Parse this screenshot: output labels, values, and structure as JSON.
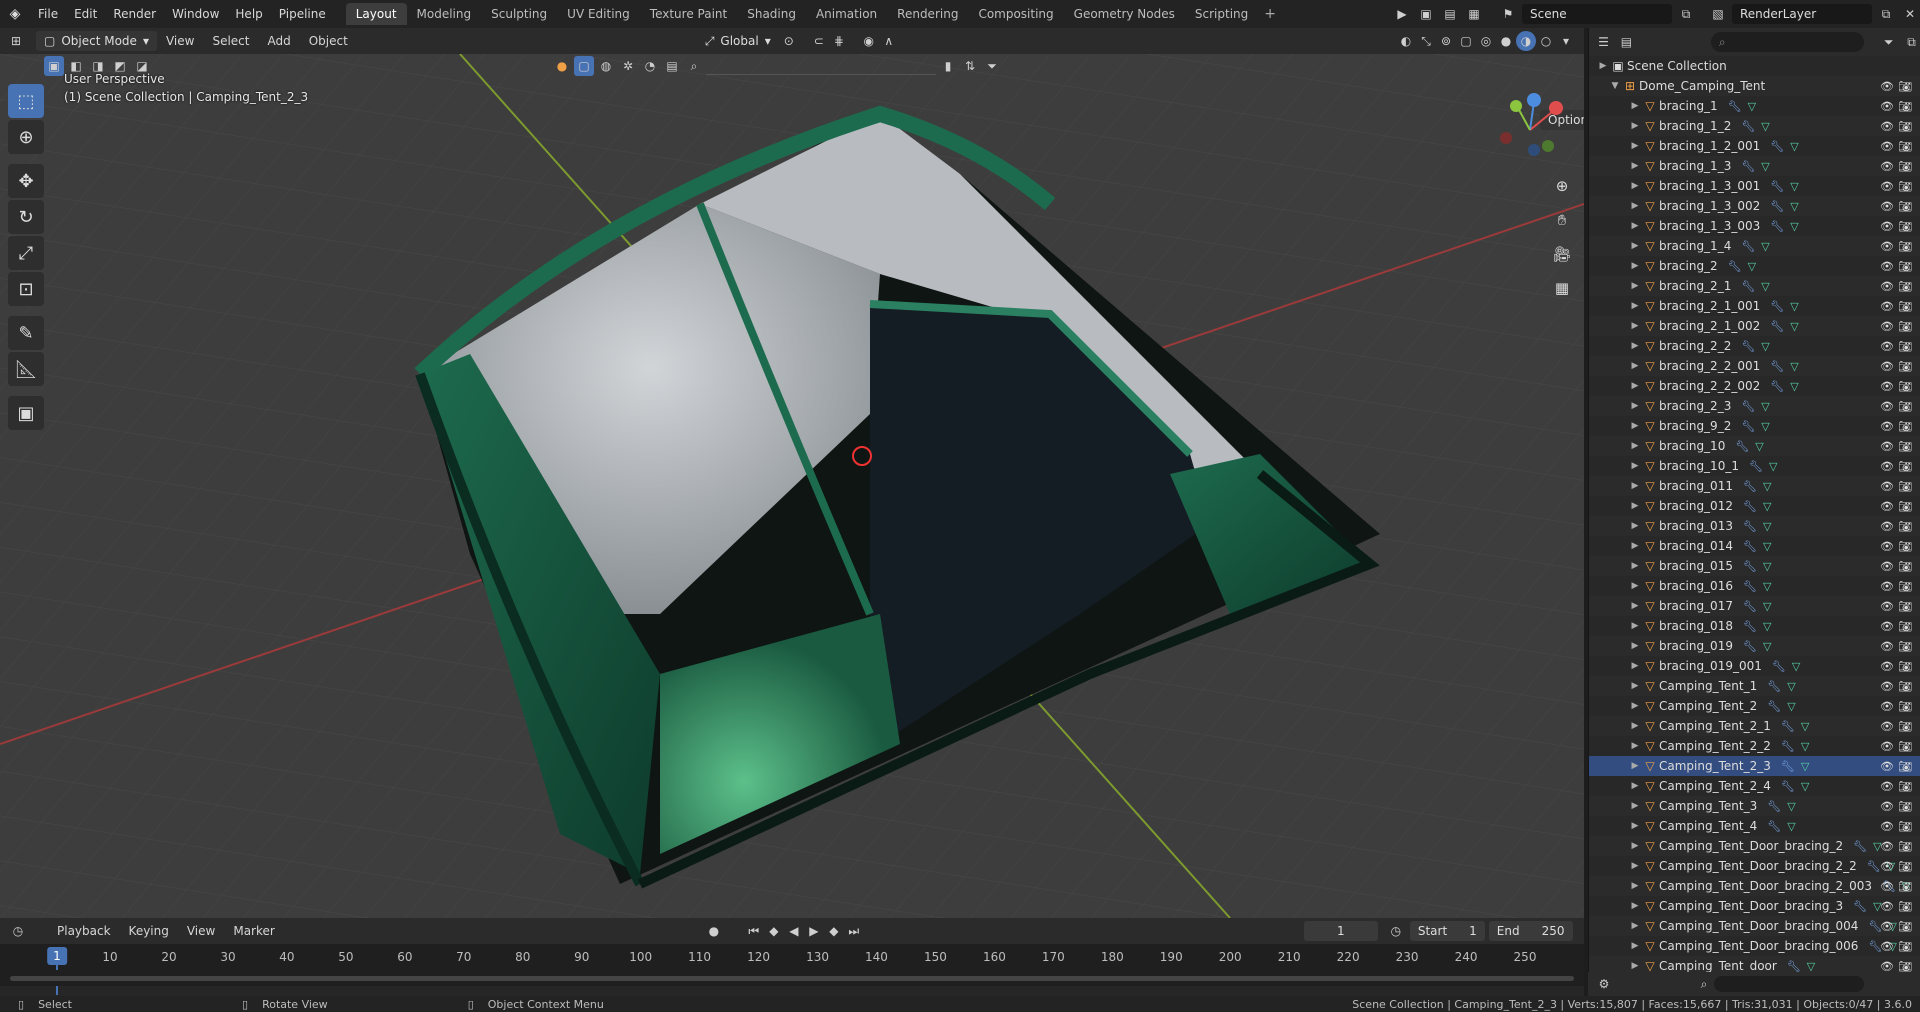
{
  "topbar": {
    "menus": [
      "File",
      "Edit",
      "Render",
      "Window",
      "Help",
      "Pipeline"
    ],
    "workspaces": [
      "Layout",
      "Modeling",
      "Sculpting",
      "UV Editing",
      "Texture Paint",
      "Shading",
      "Animation",
      "Rendering",
      "Compositing",
      "Geometry Nodes",
      "Scripting"
    ],
    "active_workspace": "Layout",
    "scene": "Scene",
    "view_layer": "RenderLayer"
  },
  "viewport_header": {
    "mode": "Object Mode",
    "menus": [
      "View",
      "Select",
      "Add",
      "Object"
    ],
    "orientation": "Global",
    "options_label": "Options"
  },
  "viewport": {
    "perspective": "User Perspective",
    "context": "(1) Scene Collection | Camping_Tent_2_3"
  },
  "timeline": {
    "menus": [
      "Playback",
      "Keying",
      "View",
      "Marker"
    ],
    "current_frame": "1",
    "start_label": "Start",
    "start_value": "1",
    "end_label": "End",
    "end_value": "250",
    "ticks": [
      "1",
      "10",
      "20",
      "30",
      "40",
      "50",
      "60",
      "70",
      "80",
      "90",
      "100",
      "110",
      "120",
      "130",
      "140",
      "150",
      "160",
      "170",
      "180",
      "190",
      "200",
      "210",
      "220",
      "230",
      "240",
      "250"
    ]
  },
  "status": {
    "select": "Select",
    "rotate": "Rotate View",
    "context_menu": "Object Context Menu",
    "stats": "Scene Collection | Camping_Tent_2_3 | Verts:15,807 | Faces:15,667 | Tris:31,031 | Objects:0/47 | 3.6.0"
  },
  "outliner": {
    "root": "Scene Collection",
    "collection": "Dome_Camping_Tent",
    "items": [
      "bracing_1",
      "bracing_1_2",
      "bracing_1_2_001",
      "bracing_1_3",
      "bracing_1_3_001",
      "bracing_1_3_002",
      "bracing_1_3_003",
      "bracing_1_4",
      "bracing_2",
      "bracing_2_1",
      "bracing_2_1_001",
      "bracing_2_1_002",
      "bracing_2_2",
      "bracing_2_2_001",
      "bracing_2_2_002",
      "bracing_2_3",
      "bracing_9_2",
      "bracing_10",
      "bracing_10_1",
      "bracing_011",
      "bracing_012",
      "bracing_013",
      "bracing_014",
      "bracing_015",
      "bracing_016",
      "bracing_017",
      "bracing_018",
      "bracing_019",
      "bracing_019_001",
      "Camping_Tent_1",
      "Camping_Tent_2",
      "Camping_Tent_2_1",
      "Camping_Tent_2_2",
      "Camping_Tent_2_3",
      "Camping_Tent_2_4",
      "Camping_Tent_3",
      "Camping_Tent_4",
      "Camping_Tent_Door_bracing_2",
      "Camping_Tent_Door_bracing_2_2",
      "Camping_Tent_Door_bracing_2_003",
      "Camping_Tent_Door_bracing_3",
      "Camping_Tent_Door_bracing_004",
      "Camping_Tent_Door_bracing_006",
      "Camping_Tent_door"
    ],
    "selected": "Camping_Tent_2_3"
  },
  "colors": {
    "accent": "#4772b3",
    "grid_x": "#c24242",
    "grid_y": "#8ab733",
    "tent_green": "#16503c"
  }
}
